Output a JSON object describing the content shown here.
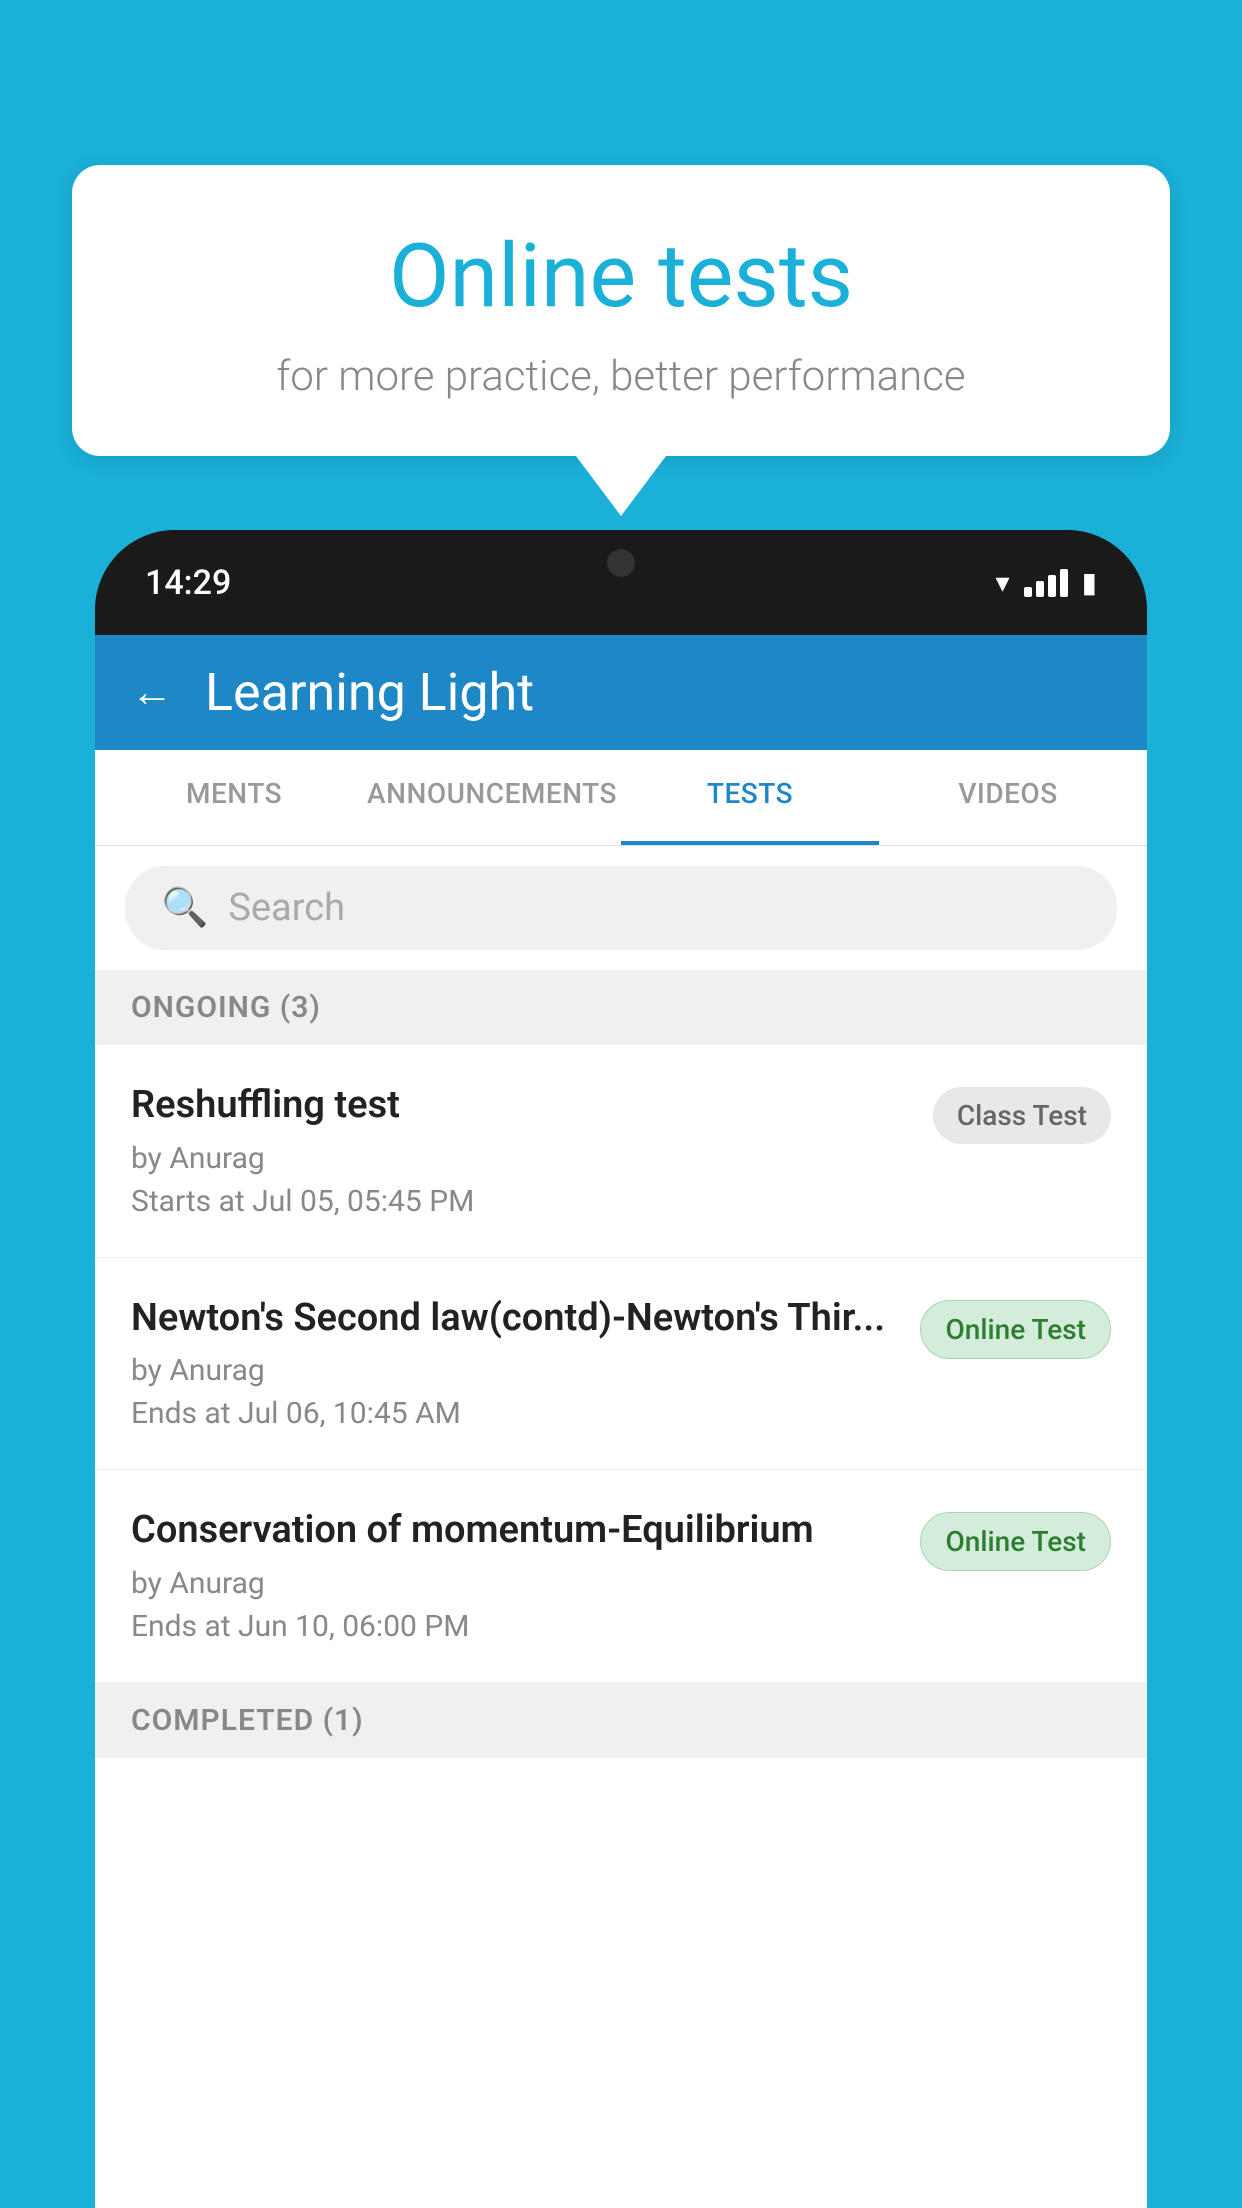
{
  "background": {
    "color": "#1ab0d8"
  },
  "speech_bubble": {
    "title": "Online tests",
    "subtitle": "for more practice, better performance"
  },
  "phone": {
    "time": "14:29",
    "app_title": "Learning Light",
    "back_label": "←"
  },
  "tabs": [
    {
      "label": "MENTS",
      "active": false
    },
    {
      "label": "ANNOUNCEMENTS",
      "active": false
    },
    {
      "label": "TESTS",
      "active": true
    },
    {
      "label": "VIDEOS",
      "active": false
    }
  ],
  "search": {
    "placeholder": "Search"
  },
  "ongoing_section": {
    "label": "ONGOING (3)"
  },
  "tests": [
    {
      "name": "Reshuffling test",
      "author": "by Anurag",
      "date": "Starts at  Jul 05, 05:45 PM",
      "badge": "Class Test",
      "badge_type": "class"
    },
    {
      "name": "Newton's Second law(contd)-Newton's Thir...",
      "author": "by Anurag",
      "date": "Ends at  Jul 06, 10:45 AM",
      "badge": "Online Test",
      "badge_type": "online"
    },
    {
      "name": "Conservation of momentum-Equilibrium",
      "author": "by Anurag",
      "date": "Ends at  Jun 10, 06:00 PM",
      "badge": "Online Test",
      "badge_type": "online"
    }
  ],
  "completed_section": {
    "label": "COMPLETED (1)"
  }
}
